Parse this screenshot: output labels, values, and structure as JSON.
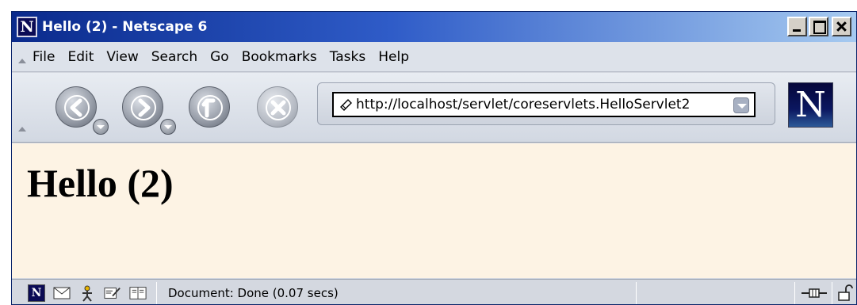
{
  "window": {
    "title": "Hello (2) - Netscape 6",
    "app_logo_letter": "N"
  },
  "menubar": {
    "items": [
      {
        "label": "File"
      },
      {
        "label": "Edit"
      },
      {
        "label": "View"
      },
      {
        "label": "Search"
      },
      {
        "label": "Go"
      },
      {
        "label": "Bookmarks"
      },
      {
        "label": "Tasks"
      },
      {
        "label": "Help"
      }
    ]
  },
  "navbar": {
    "buttons": [
      {
        "name": "back",
        "icon": "arrow-left-icon",
        "has_dropdown": true
      },
      {
        "name": "forward",
        "icon": "arrow-right-icon",
        "has_dropdown": true
      },
      {
        "name": "reload",
        "icon": "reload-icon",
        "has_dropdown": false
      },
      {
        "name": "stop",
        "icon": "stop-icon",
        "has_dropdown": false,
        "disabled": true
      }
    ],
    "url": "http://localhost/servlet/coreservlets.HelloServlet2",
    "throbber_letter": "N"
  },
  "content": {
    "heading": "Hello (2)",
    "background": "#fdf3e4"
  },
  "statusbar": {
    "status_text": "Document: Done (0.07 secs)"
  }
}
